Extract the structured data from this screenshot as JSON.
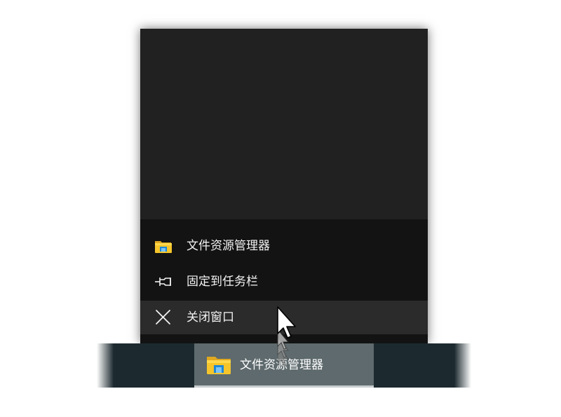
{
  "jumplist": {
    "items": [
      {
        "label": "文件资源管理器",
        "icon": "file-explorer-icon"
      },
      {
        "label": "固定到任务栏",
        "icon": "pin-icon"
      },
      {
        "label": "关闭窗口",
        "icon": "close-icon"
      }
    ]
  },
  "taskbar": {
    "button_label": "文件资源管理器",
    "button_icon": "file-explorer-icon"
  },
  "colors": {
    "preview_bg": "#212121",
    "menu_bg": "#131313",
    "hover_bg": "#2b2b2b",
    "taskbar_bg": "#1c2a2f",
    "taskbar_active_bg": "#5e6a6d",
    "folder_yellow": "#f5c52b",
    "folder_blue": "#1e88d6"
  }
}
